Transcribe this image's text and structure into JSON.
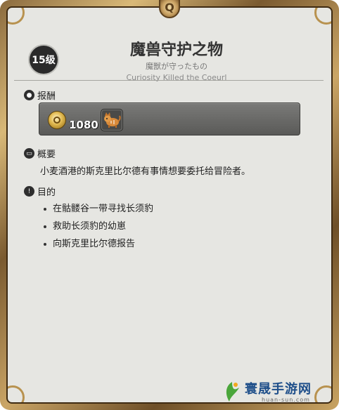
{
  "quest": {
    "level": "15级",
    "title": "魔兽守护之物",
    "subtitle_jp": "魔獣が守ったもの",
    "subtitle_en": "Curiosity Killed the Coeurl"
  },
  "reward": {
    "heading": "报酬",
    "gil_amount": "1080",
    "gil_icon": "gil-coin-icon",
    "item_icon": "coeurl-pet-icon"
  },
  "summary": {
    "heading": "概要",
    "text": "小麦酒港的斯克里比尔德有事情想要委托给冒险者。"
  },
  "objectives": {
    "heading": "目的",
    "items": [
      "在骷髅谷一带寻找长须豹",
      "救助长须豹的幼崽",
      "向斯克里比尔德报告"
    ]
  },
  "watermark": {
    "title": "寰晟手游网",
    "url": "huan-sun.com"
  },
  "colors": {
    "panel_bg": "#e6e6e2",
    "frame_gold": "#c9a463",
    "badge_bg": "#2a2a2a",
    "reward_box": "#6a6a68"
  }
}
